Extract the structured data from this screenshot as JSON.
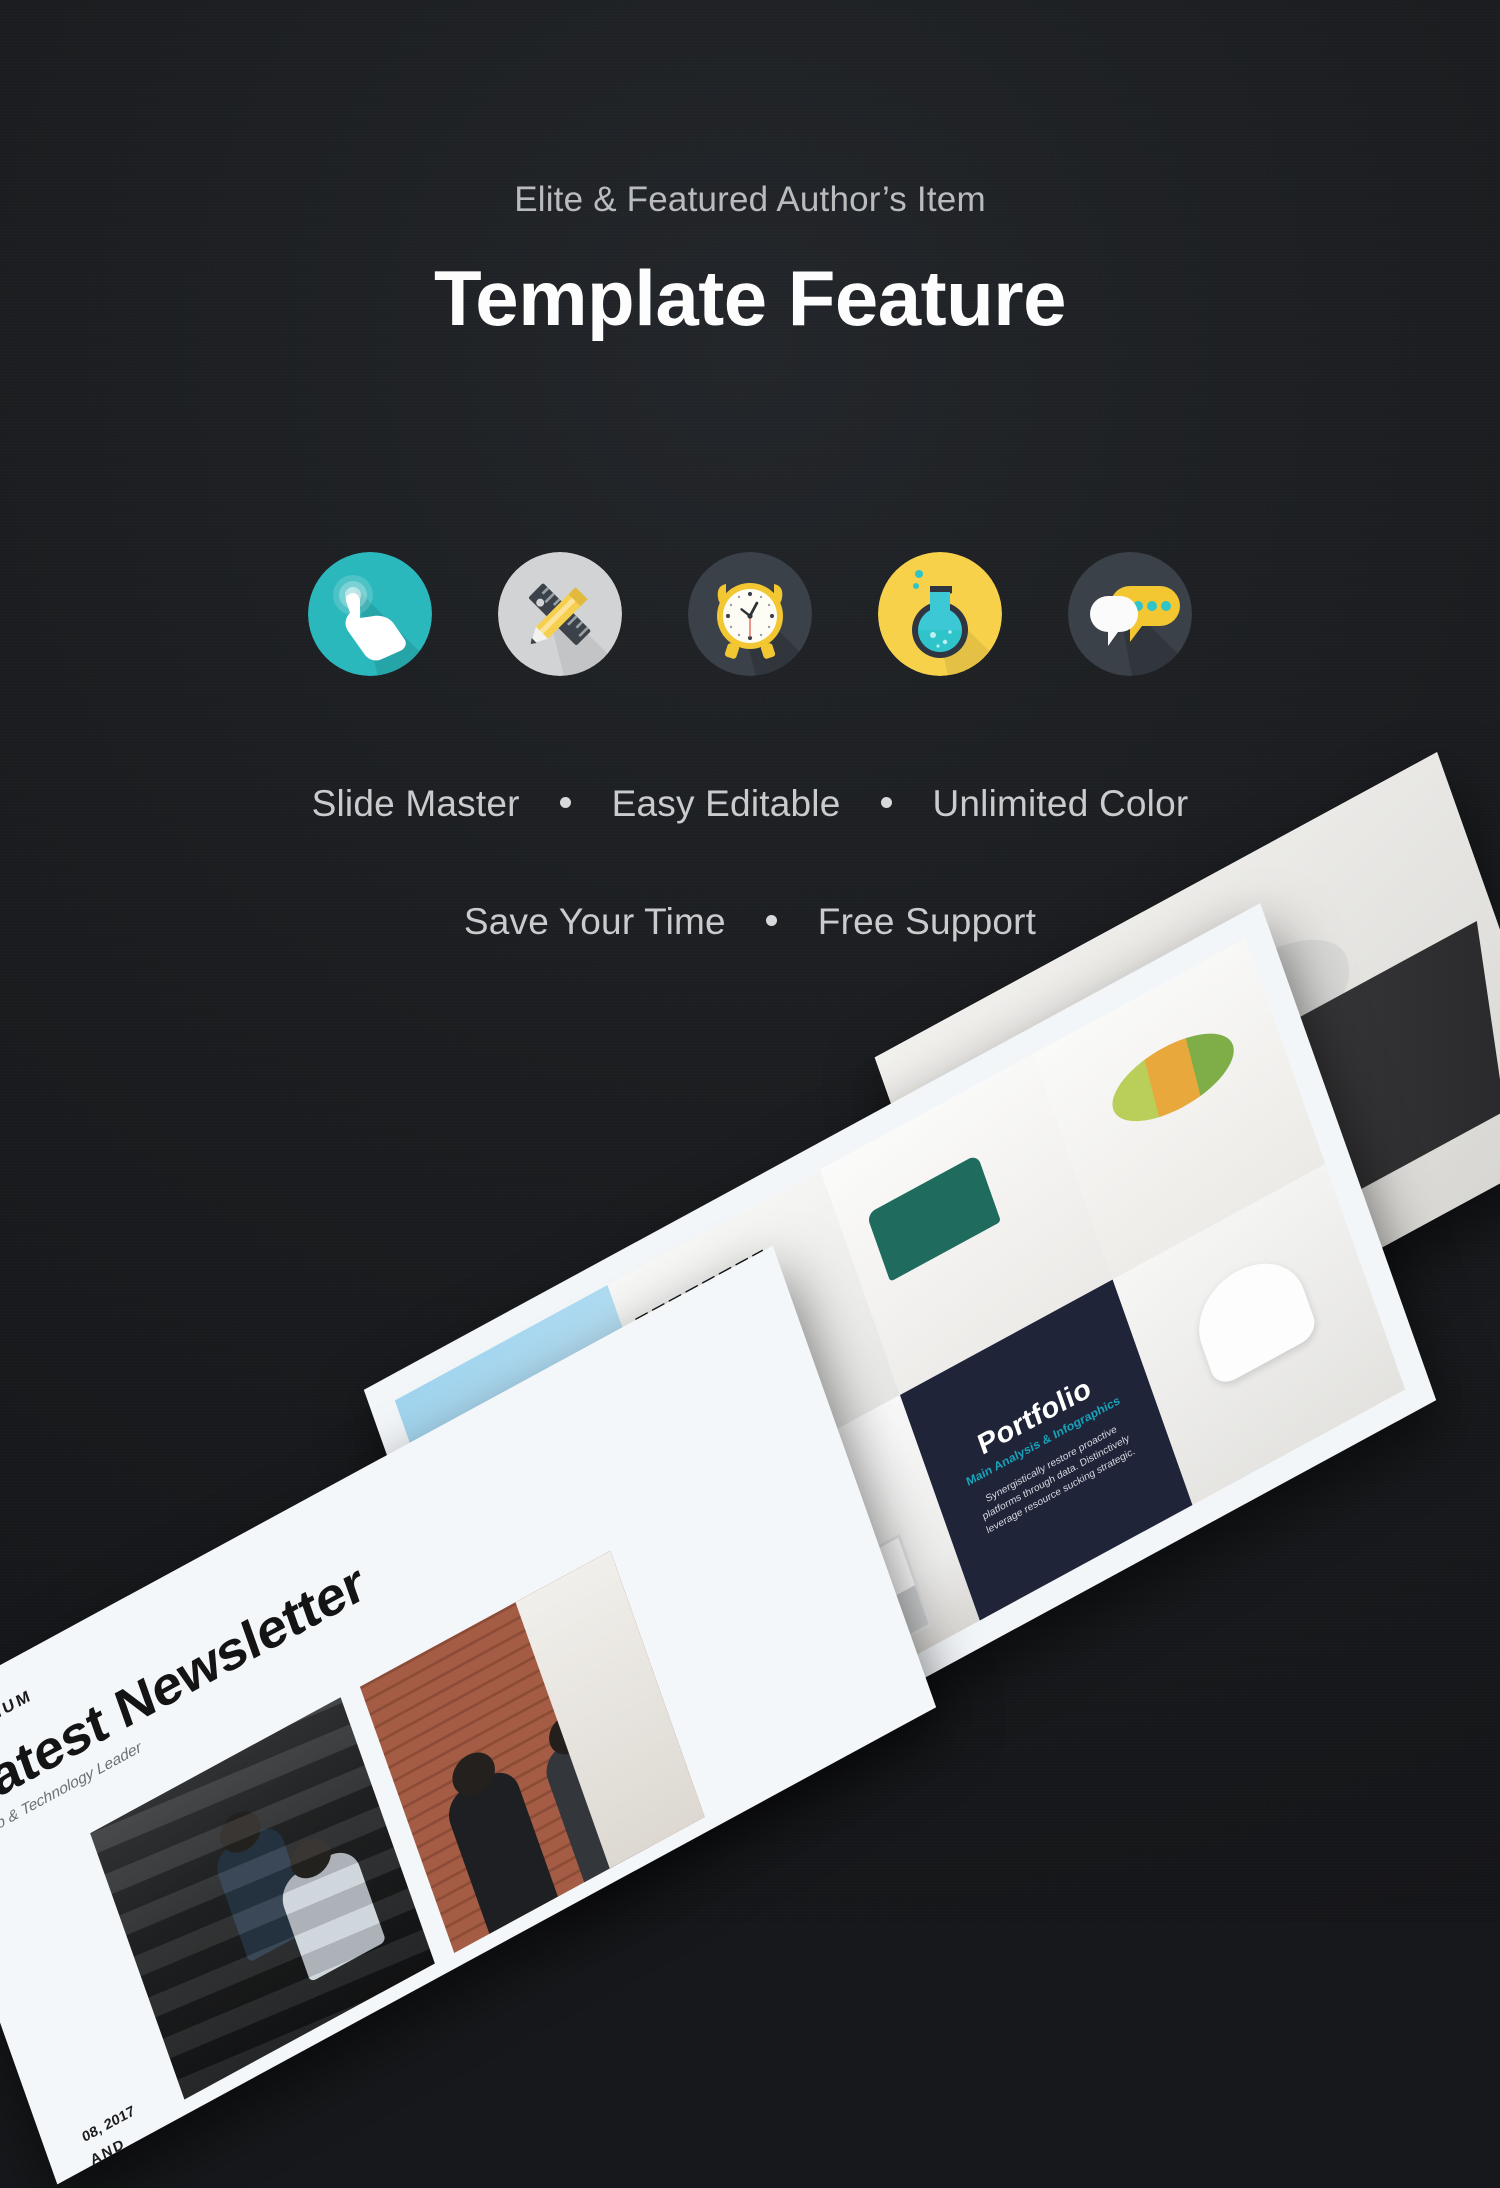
{
  "theme": {
    "background": "#1c1e21",
    "title_color": "#fdfdfd",
    "body_color": "#c9cbcd",
    "accent_teal": "#2bb8bd",
    "accent_yellow": "#f8d14a",
    "accent_gray": "#d2d3d5",
    "accent_slate": "#3b4149",
    "portfolio_navy": "#1f2438",
    "portfolio_sub_teal": "#17a2b8"
  },
  "header": {
    "eyebrow": "Elite & Featured Author’s Item",
    "title": "Template Feature"
  },
  "icons": [
    {
      "name": "touch-click-icon",
      "label": "Touch / Click",
      "circle": "#2bb8bd"
    },
    {
      "name": "pencil-ruler-icon",
      "label": "Pencil & Ruler",
      "circle": "#d2d3d5"
    },
    {
      "name": "alarm-clock-icon",
      "label": "Alarm Clock",
      "circle": "#3b4149"
    },
    {
      "name": "flask-icon",
      "label": "Science Flask",
      "circle": "#f8d14a"
    },
    {
      "name": "chat-bubbles-icon",
      "label": "Chat Bubbles",
      "circle": "#3b4149"
    }
  ],
  "features": {
    "line1": [
      "Slide Master",
      "Easy Editable",
      "Unlimited Color"
    ],
    "line2": [
      "Save Your Time",
      "Free Support"
    ]
  },
  "mockups": {
    "desk": {
      "name": "desk-photo-slide",
      "description": "Top-down photo of a woman working at a dark desk with a laptop and a sheet of paper"
    },
    "portfolio": {
      "name": "portfolio-grid-slide",
      "title": "Portfolio",
      "subtitle": "Main Analysis & Infographics",
      "body": "Synergistically restore proactive platforms through data. Distinctively leverage resource sucking strategic.",
      "tiles": [
        "sky-building-photo",
        "mountain-clouds-photo",
        "grid-pillow-room-photo",
        "green-sofa-photo",
        "kitchen-shelf-photo",
        "colorful-plant-table-photo",
        "white-chair-photo"
      ]
    },
    "newsletter": {
      "name": "newsletter-slide",
      "premium": "PREMIUM",
      "title": "Latest Newsletter",
      "subtitle": "Web & Technology Leader",
      "date": "08, 2017",
      "brand": "AND",
      "photos": [
        "people-on-stairs-photo",
        "people-by-brick-wall-photo"
      ]
    }
  }
}
